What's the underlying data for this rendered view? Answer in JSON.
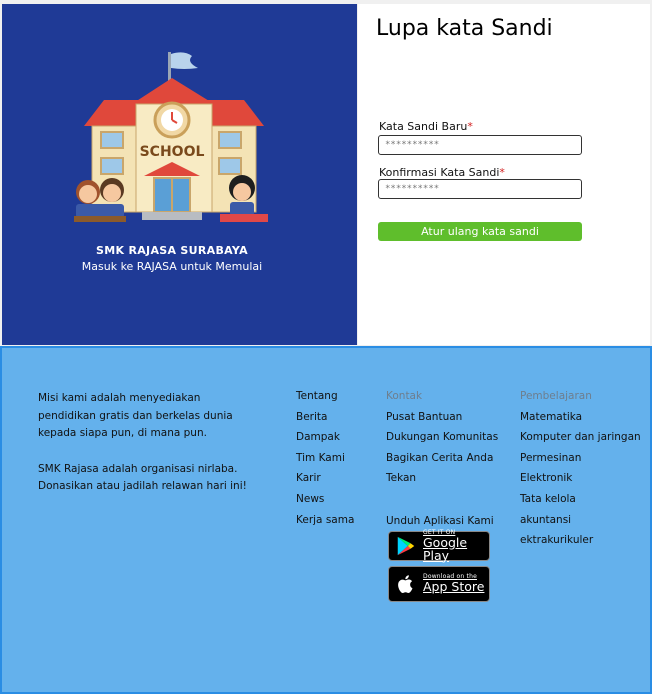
{
  "hero": {
    "illustration_icon": "school-building-illustration",
    "school_sign": "SCHOOL",
    "school_name": "SMK RAJASA SURABAYA",
    "tagline": "Masuk ke RAJASA untuk Memulai",
    "background": "#1f3a96"
  },
  "form": {
    "title": "Lupa kata Sandi",
    "new_password": {
      "label": "Kata Sandi Baru",
      "required_mark": "*",
      "placeholder": "**********"
    },
    "confirm_password": {
      "label": "Konfirmasi Kata Sandi",
      "required_mark": "*",
      "placeholder": "**********"
    },
    "submit_label": "Atur ulang kata sandi",
    "submit_color": "#5fbe2c"
  },
  "footer": {
    "background": "#64b1ec",
    "mission_1": "Misi kami adalah menyediakan pendidikan gratis dan berkelas dunia kepada siapa pun, di mana pun.",
    "mission_2": "SMK Rajasa adalah organisasi nirlaba. Donasikan atau jadilah relawan hari ini!",
    "about_links": [
      "Tentang",
      "Berita",
      "Dampak",
      "Tim Kami",
      "Karir",
      "News",
      "Kerja sama"
    ],
    "contact": {
      "heading": "Kontak",
      "links": [
        "Pusat Bantuan",
        "Dukungan Komunitas",
        "Bagikan Cerita Anda",
        "Tekan"
      ]
    },
    "learning": {
      "heading": "Pembelajaran",
      "links": [
        "Matematika",
        "Komputer dan jaringan",
        "Permesinan",
        "Elektronik",
        "Tata kelola",
        "akuntansi",
        "ektrakurikuler"
      ]
    },
    "apps": {
      "title": "Unduh Aplikasi Kami",
      "google_play": {
        "small": "GET IT ON",
        "big": "Google Play",
        "icon": "google-play-icon"
      },
      "app_store": {
        "small": "Download on the",
        "big": "App Store",
        "icon": "apple-icon"
      }
    }
  }
}
